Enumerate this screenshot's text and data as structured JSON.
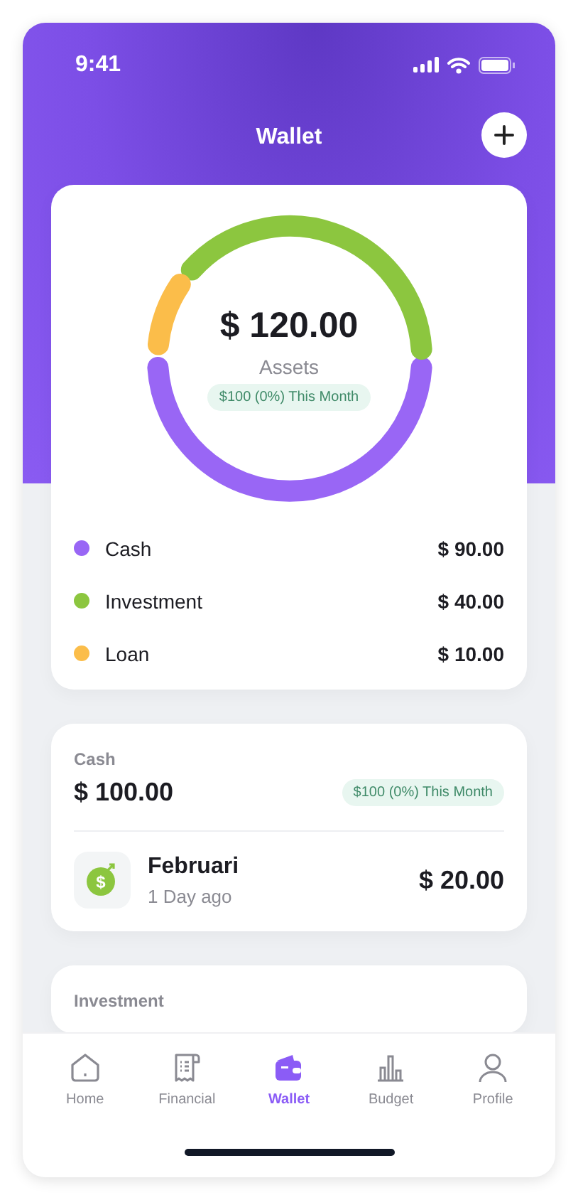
{
  "status_bar": {
    "time": "9:41"
  },
  "header": {
    "title": "Wallet"
  },
  "assets_card": {
    "total": "$ 120.00",
    "label": "Assets",
    "change": "$100 (0%) This Month",
    "legend": [
      {
        "name": "Cash",
        "amount": "$ 90.00",
        "color": "#9966f5"
      },
      {
        "name": "Investment",
        "amount": "$ 40.00",
        "color": "#8cc63f"
      },
      {
        "name": "Loan",
        "amount": "$ 10.00",
        "color": "#fbbd4a"
      }
    ]
  },
  "accounts": [
    {
      "title": "Cash",
      "amount": "$ 100.00",
      "change": "$100 (0%) This Month",
      "transactions": [
        {
          "icon_glyph": "$",
          "name": "Februari",
          "time": "1 Day ago",
          "amount": "$ 20.00"
        }
      ]
    },
    {
      "title": "Investment"
    }
  ],
  "nav": [
    {
      "label": "Home",
      "kind": "home",
      "selected": false
    },
    {
      "label": "Financial",
      "kind": "receipt",
      "selected": false
    },
    {
      "label": "Wallet",
      "kind": "wallet",
      "selected": true
    },
    {
      "label": "Budget",
      "kind": "chart",
      "selected": false
    },
    {
      "label": "Profile",
      "kind": "person",
      "selected": false
    }
  ]
}
